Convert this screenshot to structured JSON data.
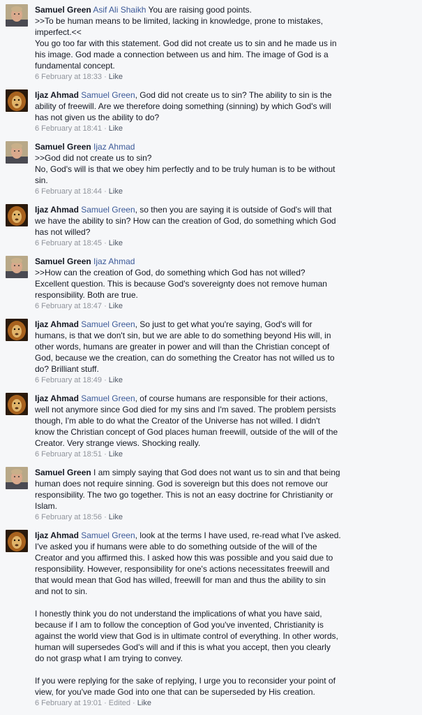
{
  "comments": [
    {
      "author": "Samuel Green",
      "avatar": "samuel-photo",
      "mention": "Asif Ali Shaikh",
      "text": " You are raising good points.\n>>To be human means to be limited, lacking in knowledge, prone to mistakes, imperfect.<<\nYou go too far with this statement. God did not create us to sin and he made us in his image. God made a connection between us and him. The image of God is a fundamental concept.",
      "extra": [],
      "time": "6 February at 18:33",
      "edited": "",
      "like": "Like"
    },
    {
      "author": "Ijaz Ahmad",
      "avatar": "lion-photo",
      "mention": "Samuel Green",
      "text": ", God did not create us to sin? The ability to sin is the ability of freewill. Are we therefore doing something (sinning) by which God's will has not given us the ability to do?",
      "extra": [],
      "time": "6 February at 18:41",
      "edited": "",
      "like": "Like"
    },
    {
      "author": "Samuel Green",
      "avatar": "samuel-photo",
      "mention": "Ijaz Ahmad",
      "text": "\n>>God did not create us to sin?\nNo, God's will is that we obey him perfectly and to be truly human is to be without sin.",
      "extra": [],
      "time": "6 February at 18:44",
      "edited": "",
      "like": "Like"
    },
    {
      "author": "Ijaz Ahmad",
      "avatar": "lion-photo",
      "mention": "Samuel Green",
      "text": ", so then you are saying it is outside of God's will that we have the ability to sin? How can the creation of God, do something which God has not willed?",
      "extra": [],
      "time": "6 February at 18:45",
      "edited": "",
      "like": "Like"
    },
    {
      "author": "Samuel Green",
      "avatar": "samuel-photo",
      "mention": "Ijaz Ahmad",
      "text": "\n>>How can the creation of God, do something which God has not willed?\nExcellent question. This is because God's sovereignty does not remove human responsibility. Both are true.",
      "extra": [],
      "time": "6 February at 18:47",
      "edited": "",
      "like": "Like"
    },
    {
      "author": "Ijaz Ahmad",
      "avatar": "lion-photo",
      "mention": "Samuel Green",
      "text": ", So just to get what you're saying, God's will for humans, is that we don't sin, but we are able to do something beyond His will, in other words, humans are greater in power and will than the Christian concept of God, because we the creation, can do something the Creator has not willed us to do? Brilliant stuff.",
      "extra": [],
      "time": "6 February at 18:49",
      "edited": "",
      "like": "Like"
    },
    {
      "author": "Ijaz Ahmad",
      "avatar": "lion-photo",
      "mention": "Samuel Green",
      "text": ", of course humans are responsible for their actions, well not anymore since God died for my sins and I'm saved. The problem persists though, I'm able to do what the Creator of the Universe has not willed. I didn't know the Christian concept of God places human freewill, outside of the will of the Creator. Very strange views. Shocking really.",
      "extra": [],
      "time": "6 February at 18:51",
      "edited": "",
      "like": "Like"
    },
    {
      "author": "Samuel Green",
      "avatar": "samuel-photo",
      "mention": "",
      "text": " I am simply saying that God does not want us to sin and that being human does not require sinning. God is sovereign but this does not remove our responsibility. The two go together. This is not an easy doctrine for Christianity or Islam.",
      "extra": [],
      "time": "6 February at 18:56",
      "edited": "",
      "like": "Like"
    },
    {
      "author": "Ijaz Ahmad",
      "avatar": "lion-photo",
      "mention": "Samuel Green",
      "text": ", look at the terms I have used, re-read what I've asked. I've asked you if humans were able to do something outside of the will of the Creator and you affirmed this. I asked how this was possible and you said due to responsibility. However, responsibility for one's actions necessitates freewill and that would mean that God has willed, freewill for man and thus the ability to sin and not to sin.",
      "extra": [
        "I honestly think you do not understand the implications of what you have said, because if I am to follow the conception of God you've invented, Christianity is against the world view that God is in ultimate control of everything. In other words, human will supersedes God's will and if this is what you accept, then you clearly do not grasp what I am trying to convey.",
        "If you were replying for the sake of replying, I urge you to reconsider your point of view, for you've made God into one that can be superseded by His creation."
      ],
      "time": "6 February at 19:01",
      "edited": "Edited",
      "like": "Like"
    }
  ]
}
